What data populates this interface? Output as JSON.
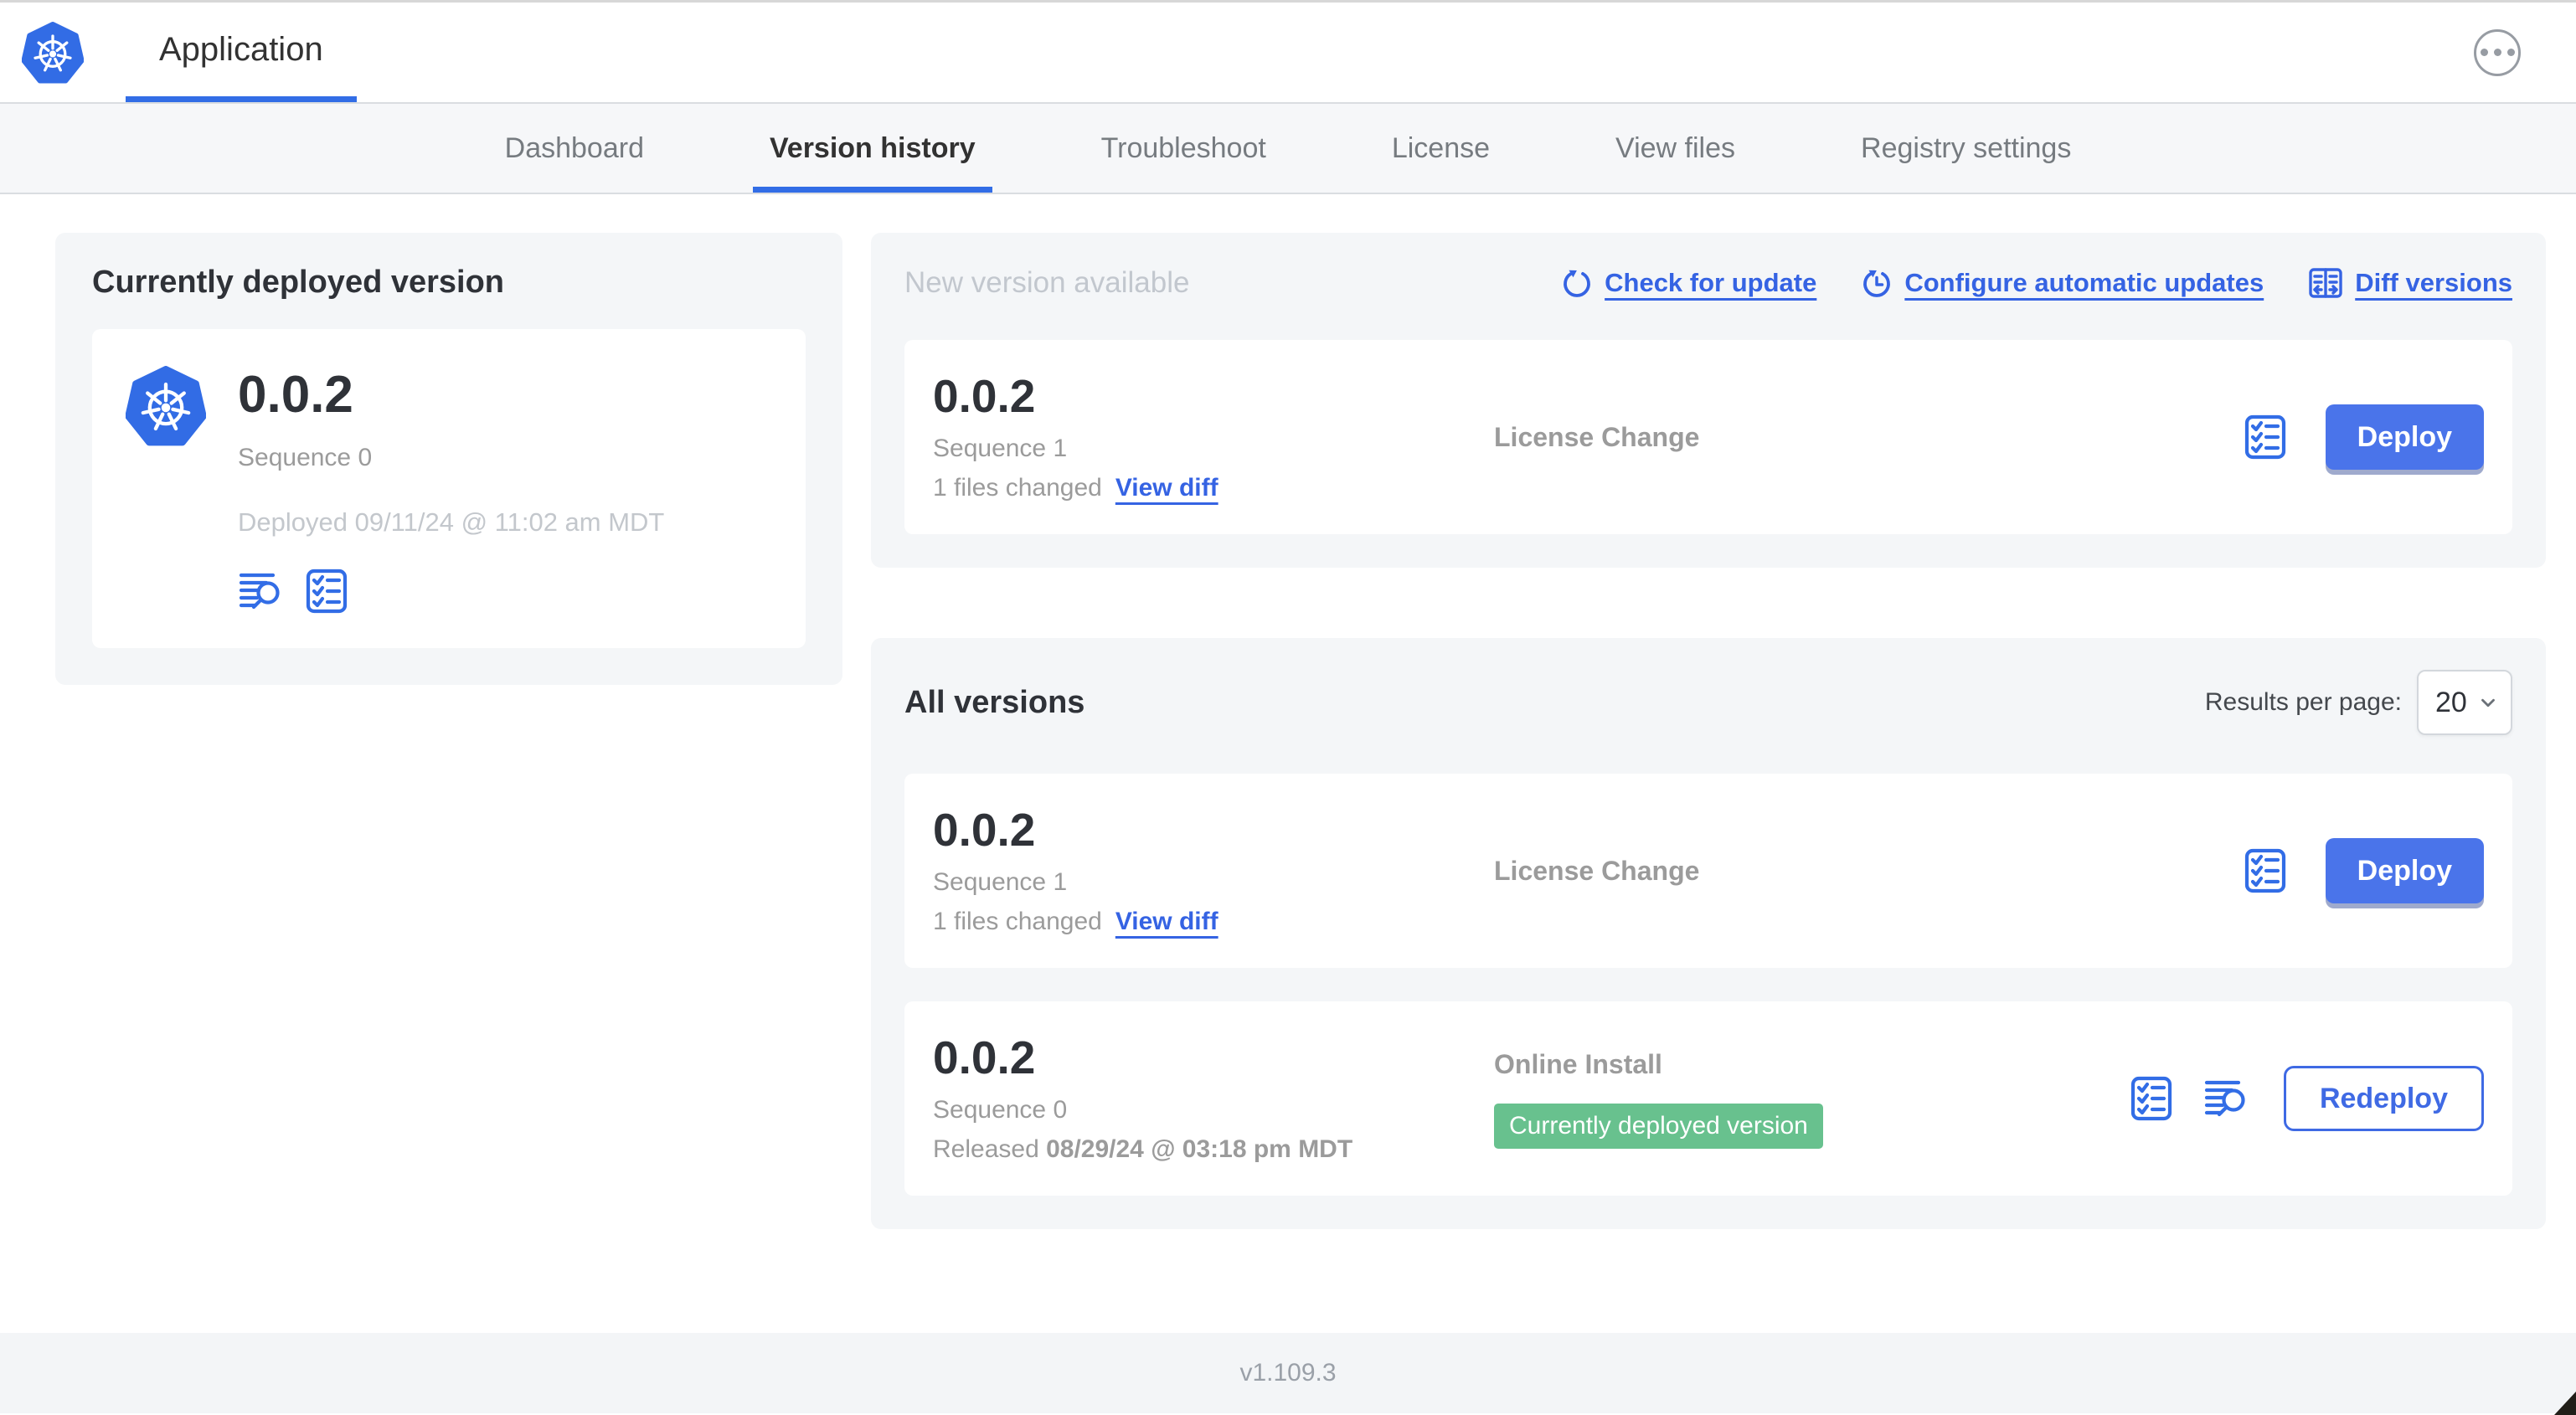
{
  "header": {
    "app_name": "Application",
    "menu_icon": "ellipsis-icon"
  },
  "nav": {
    "tabs": [
      {
        "label": "Dashboard",
        "active": false
      },
      {
        "label": "Version history",
        "active": true
      },
      {
        "label": "Troubleshoot",
        "active": false
      },
      {
        "label": "License",
        "active": false
      },
      {
        "label": "View files",
        "active": false
      },
      {
        "label": "Registry settings",
        "active": false
      }
    ]
  },
  "current_version": {
    "title": "Currently deployed version",
    "version": "0.0.2",
    "sequence": "Sequence 0",
    "deployed": "Deployed 09/11/24 @ 11:02 am MDT",
    "icons": [
      "logs-icon",
      "checklist-icon"
    ]
  },
  "new_version": {
    "title": "New version available",
    "links": [
      {
        "label": "Check for update",
        "icon": "update-icon"
      },
      {
        "label": "Configure automatic updates",
        "icon": "auto-update-icon"
      },
      {
        "label": "Diff versions",
        "icon": "diff-icon"
      }
    ],
    "row": {
      "version": "0.0.2",
      "sequence": "Sequence 1",
      "files_changed": "1 files changed",
      "view_diff_label": "View diff",
      "source": "License Change",
      "deploy_label": "Deploy",
      "icons": [
        "checklist-icon"
      ]
    }
  },
  "all_versions": {
    "title": "All versions",
    "results_per_page_label": "Results per page:",
    "results_per_page_value": "20",
    "rows": [
      {
        "version": "0.0.2",
        "sequence": "Sequence 1",
        "files_changed": "1 files changed",
        "view_diff_label": "View diff",
        "source": "License Change",
        "deploy_label": "Deploy",
        "icons": [
          "checklist-icon"
        ]
      },
      {
        "version": "0.0.2",
        "sequence": "Sequence 0",
        "released_prefix": "Released ",
        "released_date": "08/29/24 @ 03:18 pm MDT",
        "source": "Online Install",
        "badge": "Currently deployed version",
        "redeploy_label": "Redeploy",
        "icons": [
          "checklist-icon",
          "logs-icon"
        ]
      }
    ]
  },
  "footer": {
    "app_version": "v1.109.3"
  },
  "colors": {
    "primary_blue": "#326de6",
    "link_blue": "#3563e3",
    "button_blue": "#4a74ea",
    "success_green": "#68c18e",
    "muted_gray": "#9b9b9b",
    "light_gray_text": "#c3c7cd",
    "dark_text": "#323232",
    "panel_bg": "#f4f6f8",
    "nav_bg": "#f6f7f9",
    "border": "#dadde1"
  }
}
